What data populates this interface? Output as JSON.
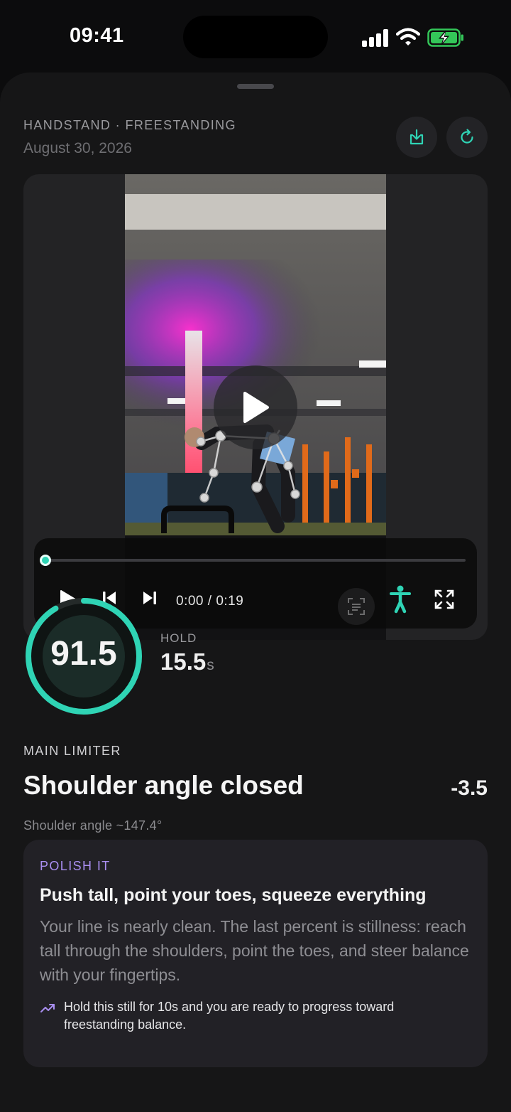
{
  "status_bar": {
    "time": "09:41"
  },
  "session": {
    "kicker": "HANDSTAND · FREESTANDING",
    "date": "August 30, 2026"
  },
  "header_actions": {
    "download_icon": "download-icon",
    "refresh_icon": "refresh-icon"
  },
  "video": {
    "time_readout": "0:00 / 0:19",
    "progress": 0.0,
    "controls": [
      "play-icon",
      "skip-back-icon",
      "skip-forward-icon",
      "scan-icon",
      "pose-overlay-icon",
      "fullscreen-icon"
    ]
  },
  "score": {
    "value": "91.5",
    "ring_fraction": 0.915,
    "ring_color": "#2fd4b5"
  },
  "hold": {
    "label": "HOLD",
    "value": "15.5",
    "unit": "s"
  },
  "limiter": {
    "kicker": "MAIN LIMITER",
    "title": "Shoulder angle closed",
    "delta": "-3.5",
    "detail": "Shoulder angle ~147.4°"
  },
  "coaching": {
    "kicker": "POLISH IT",
    "title": "Push tall, point your toes, squeeze everything",
    "body": "Your line is nearly clean. The last percent is stillness: reach tall through the shoulders, point the toes, and steer balance with your fingertips.",
    "tip": "Hold this still for 10s and you are ready to progress toward freestanding balance.",
    "accent_color": "#a98ef0"
  }
}
